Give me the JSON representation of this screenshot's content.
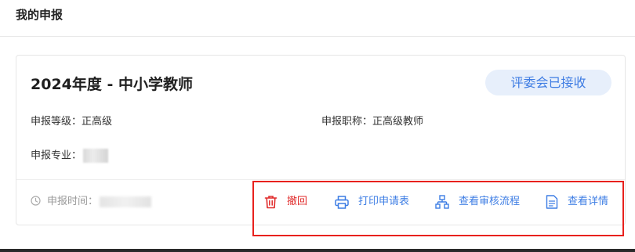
{
  "page": {
    "title": "我的申报"
  },
  "card": {
    "title": "2024年度 - 中小学教师",
    "status": "评委会已接收",
    "fields": {
      "level_label": "申报等级：正高级",
      "title_label": "申报职称：正高级教师",
      "major_label": "申报专业："
    },
    "time_label": "申报时间："
  },
  "actions": {
    "withdraw": "撤回",
    "print": "打印申请表",
    "flow": "查看审核流程",
    "detail": "查看详情"
  },
  "colors": {
    "accent": "#3d7de4",
    "danger": "#e02a2a",
    "badge_bg": "#e7effb",
    "annotation": "#e8211d"
  }
}
